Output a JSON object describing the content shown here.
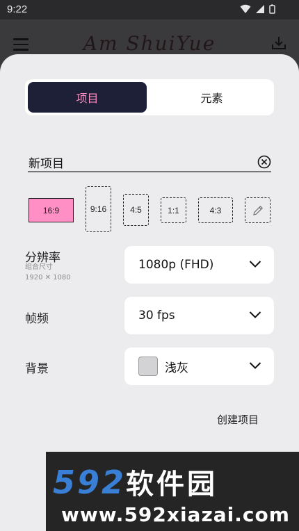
{
  "status_bar": {
    "time": "9:22"
  },
  "app_bar": {
    "title": "Am ShuiYue"
  },
  "tabs": [
    {
      "label": "项目",
      "active": true
    },
    {
      "label": "元素",
      "active": false
    }
  ],
  "project_name": {
    "value": "新项目"
  },
  "aspect_ratios": [
    {
      "label": "16:9",
      "selected": true
    },
    {
      "label": "9:16",
      "selected": false
    },
    {
      "label": "4:5",
      "selected": false
    },
    {
      "label": "1:1",
      "selected": false
    },
    {
      "label": "4:3",
      "selected": false
    },
    {
      "label": "",
      "icon": "pencil-icon",
      "selected": false
    }
  ],
  "resolution": {
    "label": "分辨率",
    "sub_label": "组合尺寸",
    "dimensions": "1920 ✕ 1080",
    "value": "1080p (FHD)"
  },
  "frame_rate": {
    "label": "帧频",
    "value": "30 fps"
  },
  "background": {
    "label": "背景",
    "value": "浅灰",
    "swatch_color": "#d3d3d5"
  },
  "create_button": {
    "label": "创建项目"
  },
  "watermark": {
    "logo_digits": "592",
    "logo_text": "软件园",
    "url": "www.592xiazai.com"
  },
  "colors": {
    "accent_pink": "#ff8fc4",
    "active_tab_bg": "#1e2038",
    "sheet_bg": "#ececee"
  }
}
